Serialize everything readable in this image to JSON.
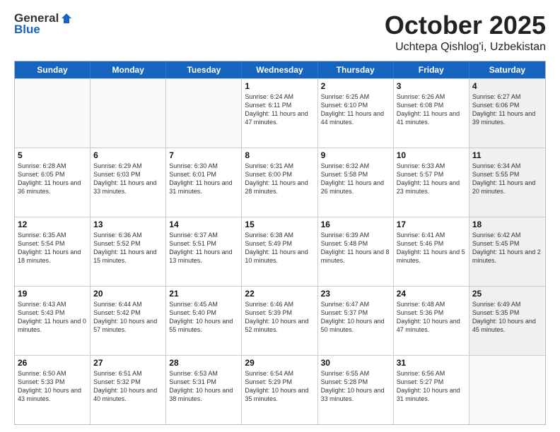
{
  "header": {
    "logo_line1": "General",
    "logo_line2": "Blue",
    "month": "October 2025",
    "location": "Uchtepa Qishlog'i, Uzbekistan"
  },
  "days": [
    "Sunday",
    "Monday",
    "Tuesday",
    "Wednesday",
    "Thursday",
    "Friday",
    "Saturday"
  ],
  "rows": [
    [
      {
        "day": "",
        "info": ""
      },
      {
        "day": "",
        "info": ""
      },
      {
        "day": "",
        "info": ""
      },
      {
        "day": "1",
        "info": "Sunrise: 6:24 AM\nSunset: 6:11 PM\nDaylight: 11 hours and 47 minutes."
      },
      {
        "day": "2",
        "info": "Sunrise: 6:25 AM\nSunset: 6:10 PM\nDaylight: 11 hours and 44 minutes."
      },
      {
        "day": "3",
        "info": "Sunrise: 6:26 AM\nSunset: 6:08 PM\nDaylight: 11 hours and 41 minutes."
      },
      {
        "day": "4",
        "info": "Sunrise: 6:27 AM\nSunset: 6:06 PM\nDaylight: 11 hours and 39 minutes."
      }
    ],
    [
      {
        "day": "5",
        "info": "Sunrise: 6:28 AM\nSunset: 6:05 PM\nDaylight: 11 hours and 36 minutes."
      },
      {
        "day": "6",
        "info": "Sunrise: 6:29 AM\nSunset: 6:03 PM\nDaylight: 11 hours and 33 minutes."
      },
      {
        "day": "7",
        "info": "Sunrise: 6:30 AM\nSunset: 6:01 PM\nDaylight: 11 hours and 31 minutes."
      },
      {
        "day": "8",
        "info": "Sunrise: 6:31 AM\nSunset: 6:00 PM\nDaylight: 11 hours and 28 minutes."
      },
      {
        "day": "9",
        "info": "Sunrise: 6:32 AM\nSunset: 5:58 PM\nDaylight: 11 hours and 26 minutes."
      },
      {
        "day": "10",
        "info": "Sunrise: 6:33 AM\nSunset: 5:57 PM\nDaylight: 11 hours and 23 minutes."
      },
      {
        "day": "11",
        "info": "Sunrise: 6:34 AM\nSunset: 5:55 PM\nDaylight: 11 hours and 20 minutes."
      }
    ],
    [
      {
        "day": "12",
        "info": "Sunrise: 6:35 AM\nSunset: 5:54 PM\nDaylight: 11 hours and 18 minutes."
      },
      {
        "day": "13",
        "info": "Sunrise: 6:36 AM\nSunset: 5:52 PM\nDaylight: 11 hours and 15 minutes."
      },
      {
        "day": "14",
        "info": "Sunrise: 6:37 AM\nSunset: 5:51 PM\nDaylight: 11 hours and 13 minutes."
      },
      {
        "day": "15",
        "info": "Sunrise: 6:38 AM\nSunset: 5:49 PM\nDaylight: 11 hours and 10 minutes."
      },
      {
        "day": "16",
        "info": "Sunrise: 6:39 AM\nSunset: 5:48 PM\nDaylight: 11 hours and 8 minutes."
      },
      {
        "day": "17",
        "info": "Sunrise: 6:41 AM\nSunset: 5:46 PM\nDaylight: 11 hours and 5 minutes."
      },
      {
        "day": "18",
        "info": "Sunrise: 6:42 AM\nSunset: 5:45 PM\nDaylight: 11 hours and 2 minutes."
      }
    ],
    [
      {
        "day": "19",
        "info": "Sunrise: 6:43 AM\nSunset: 5:43 PM\nDaylight: 11 hours and 0 minutes."
      },
      {
        "day": "20",
        "info": "Sunrise: 6:44 AM\nSunset: 5:42 PM\nDaylight: 10 hours and 57 minutes."
      },
      {
        "day": "21",
        "info": "Sunrise: 6:45 AM\nSunset: 5:40 PM\nDaylight: 10 hours and 55 minutes."
      },
      {
        "day": "22",
        "info": "Sunrise: 6:46 AM\nSunset: 5:39 PM\nDaylight: 10 hours and 52 minutes."
      },
      {
        "day": "23",
        "info": "Sunrise: 6:47 AM\nSunset: 5:37 PM\nDaylight: 10 hours and 50 minutes."
      },
      {
        "day": "24",
        "info": "Sunrise: 6:48 AM\nSunset: 5:36 PM\nDaylight: 10 hours and 47 minutes."
      },
      {
        "day": "25",
        "info": "Sunrise: 6:49 AM\nSunset: 5:35 PM\nDaylight: 10 hours and 45 minutes."
      }
    ],
    [
      {
        "day": "26",
        "info": "Sunrise: 6:50 AM\nSunset: 5:33 PM\nDaylight: 10 hours and 43 minutes."
      },
      {
        "day": "27",
        "info": "Sunrise: 6:51 AM\nSunset: 5:32 PM\nDaylight: 10 hours and 40 minutes."
      },
      {
        "day": "28",
        "info": "Sunrise: 6:53 AM\nSunset: 5:31 PM\nDaylight: 10 hours and 38 minutes."
      },
      {
        "day": "29",
        "info": "Sunrise: 6:54 AM\nSunset: 5:29 PM\nDaylight: 10 hours and 35 minutes."
      },
      {
        "day": "30",
        "info": "Sunrise: 6:55 AM\nSunset: 5:28 PM\nDaylight: 10 hours and 33 minutes."
      },
      {
        "day": "31",
        "info": "Sunrise: 6:56 AM\nSunset: 5:27 PM\nDaylight: 10 hours and 31 minutes."
      },
      {
        "day": "",
        "info": ""
      }
    ]
  ]
}
